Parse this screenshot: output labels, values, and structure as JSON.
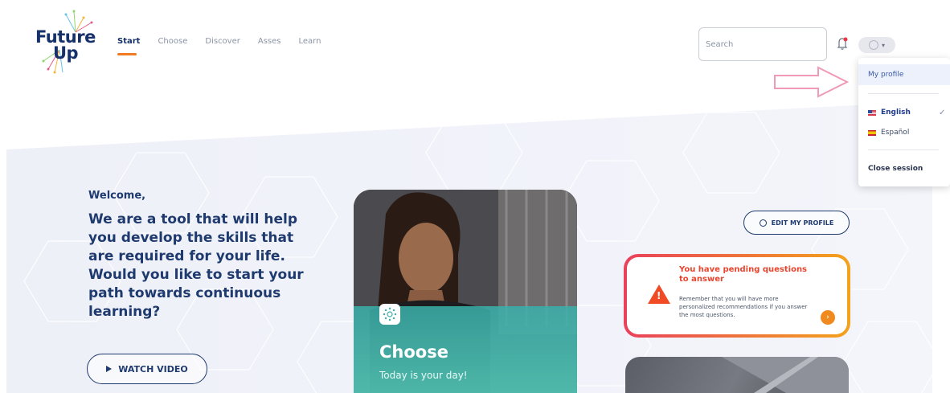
{
  "logo": {
    "line1": "Future",
    "line2": "Up"
  },
  "nav": {
    "items": [
      {
        "label": "Start",
        "active": true
      },
      {
        "label": "Choose",
        "active": false
      },
      {
        "label": "Discover",
        "active": false
      },
      {
        "label": "Asses",
        "active": false
      },
      {
        "label": "Learn",
        "active": false
      }
    ]
  },
  "search": {
    "placeholder": "Search"
  },
  "user_menu": {
    "my_profile": "My profile",
    "languages": [
      {
        "label": "English",
        "selected": true,
        "flag": "us-flag-icon"
      },
      {
        "label": "Español",
        "selected": false,
        "flag": "es-flag-icon"
      }
    ],
    "close_session": "Close session"
  },
  "hero": {
    "welcome": "Welcome,",
    "headline": "We are a tool that will help you develop the skills that are required for your life. Would you like to start your path towards continuous learning?",
    "watch_video": "WATCH VIDEO"
  },
  "choose_card": {
    "title": "Choose",
    "subtitle": "Today is your day!"
  },
  "edit_profile": "EDIT MY PROFILE",
  "pending": {
    "title": "You have pending questions to answer",
    "body": "Remember that you will have more personalized recommendations if you answer the most questions."
  },
  "colors": {
    "navy": "#1e3a6e",
    "accent_orange": "#f07b22",
    "warning_red": "#f04b25",
    "teal": "#3aafaa"
  }
}
